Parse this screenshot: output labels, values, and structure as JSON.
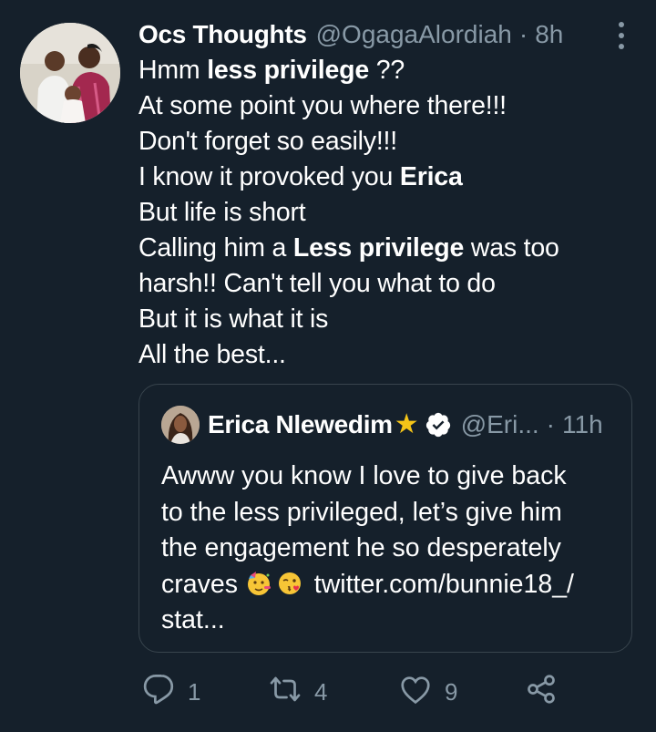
{
  "tweet": {
    "author_name": "Ocs Thoughts",
    "handle": "@OgagaAlordiah",
    "separator": "·",
    "time": "8h",
    "lines": [
      {
        "parts": [
          {
            "t": "Hmm ",
            "b": false
          },
          {
            "t": "less privilege",
            "b": true
          },
          {
            "t": " ??",
            "b": false
          }
        ]
      },
      {
        "parts": [
          {
            "t": "At some point you where there!!!",
            "b": false
          }
        ]
      },
      {
        "parts": [
          {
            "t": "Don't forget so easily!!!",
            "b": false
          }
        ]
      },
      {
        "parts": [
          {
            "t": "I know it provoked you ",
            "b": false
          },
          {
            "t": "Erica",
            "b": true
          }
        ]
      },
      {
        "parts": [
          {
            "t": "But life is short",
            "b": false
          }
        ]
      },
      {
        "parts": [
          {
            "t": "Calling him a ",
            "b": false
          },
          {
            "t": "Less privilege",
            "b": true
          },
          {
            "t": " was too",
            "b": false
          }
        ]
      },
      {
        "parts": [
          {
            "t": "harsh!! Can't tell you what to do",
            "b": false
          }
        ]
      },
      {
        "parts": [
          {
            "t": "But it is what it is",
            "b": false
          }
        ]
      },
      {
        "parts": [
          {
            "t": "All the best...",
            "b": false
          }
        ]
      }
    ]
  },
  "quote": {
    "author_name": "Erica Nlewedim",
    "star": "★",
    "handle": "@Eri...",
    "separator": "·",
    "time": "11h",
    "lines": [
      "Awww you know I love to give back",
      "to the less privileged, let’s give him",
      "the engagement he so desperately",
      "twitter.com/bunnie18_/",
      "stat..."
    ],
    "craves_word": "craves"
  },
  "actions": {
    "reply_count": "1",
    "retweet_count": "4",
    "like_count": "9"
  },
  "colors": {
    "background": "#15202b",
    "text": "#ffffff",
    "secondary": "#8899a6",
    "border": "#38444d",
    "star": "#f5c518"
  },
  "icons": [
    "more-icon",
    "verified-icon",
    "reply-icon",
    "retweet-icon",
    "like-icon",
    "share-icon",
    "party-face-emoji-icon",
    "kissing-face-emoji-icon"
  ]
}
